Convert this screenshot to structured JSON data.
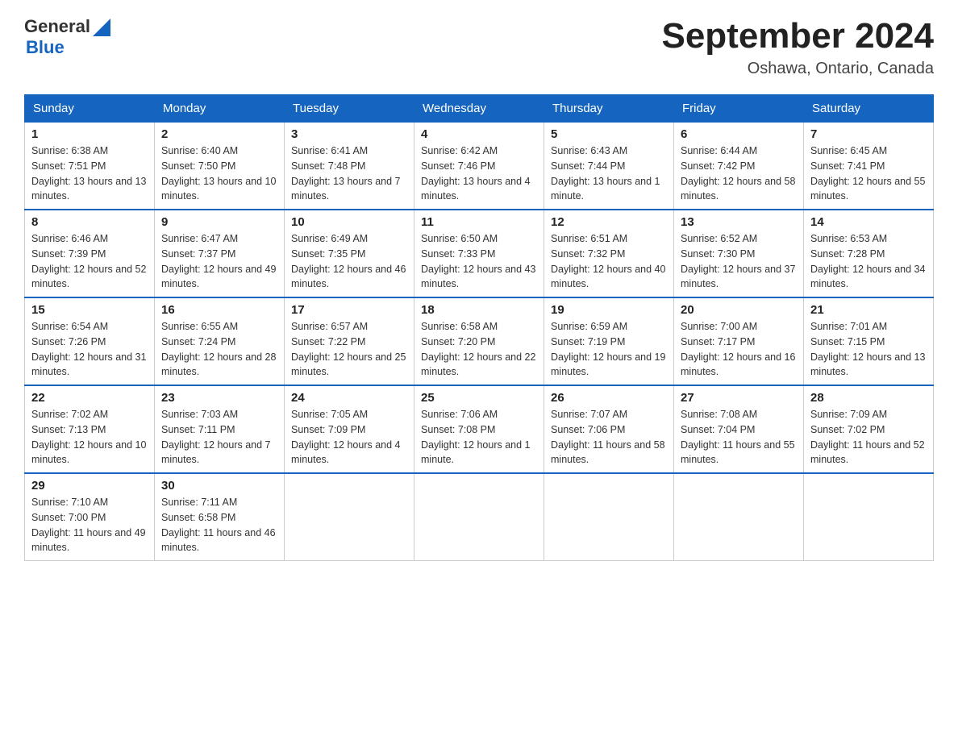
{
  "header": {
    "logo": {
      "general": "General",
      "blue": "Blue"
    },
    "title": "September 2024",
    "location": "Oshawa, Ontario, Canada"
  },
  "days_of_week": [
    "Sunday",
    "Monday",
    "Tuesday",
    "Wednesday",
    "Thursday",
    "Friday",
    "Saturday"
  ],
  "weeks": [
    [
      {
        "day": "1",
        "sunrise": "6:38 AM",
        "sunset": "7:51 PM",
        "daylight": "13 hours and 13 minutes."
      },
      {
        "day": "2",
        "sunrise": "6:40 AM",
        "sunset": "7:50 PM",
        "daylight": "13 hours and 10 minutes."
      },
      {
        "day": "3",
        "sunrise": "6:41 AM",
        "sunset": "7:48 PM",
        "daylight": "13 hours and 7 minutes."
      },
      {
        "day": "4",
        "sunrise": "6:42 AM",
        "sunset": "7:46 PM",
        "daylight": "13 hours and 4 minutes."
      },
      {
        "day": "5",
        "sunrise": "6:43 AM",
        "sunset": "7:44 PM",
        "daylight": "13 hours and 1 minute."
      },
      {
        "day": "6",
        "sunrise": "6:44 AM",
        "sunset": "7:42 PM",
        "daylight": "12 hours and 58 minutes."
      },
      {
        "day": "7",
        "sunrise": "6:45 AM",
        "sunset": "7:41 PM",
        "daylight": "12 hours and 55 minutes."
      }
    ],
    [
      {
        "day": "8",
        "sunrise": "6:46 AM",
        "sunset": "7:39 PM",
        "daylight": "12 hours and 52 minutes."
      },
      {
        "day": "9",
        "sunrise": "6:47 AM",
        "sunset": "7:37 PM",
        "daylight": "12 hours and 49 minutes."
      },
      {
        "day": "10",
        "sunrise": "6:49 AM",
        "sunset": "7:35 PM",
        "daylight": "12 hours and 46 minutes."
      },
      {
        "day": "11",
        "sunrise": "6:50 AM",
        "sunset": "7:33 PM",
        "daylight": "12 hours and 43 minutes."
      },
      {
        "day": "12",
        "sunrise": "6:51 AM",
        "sunset": "7:32 PM",
        "daylight": "12 hours and 40 minutes."
      },
      {
        "day": "13",
        "sunrise": "6:52 AM",
        "sunset": "7:30 PM",
        "daylight": "12 hours and 37 minutes."
      },
      {
        "day": "14",
        "sunrise": "6:53 AM",
        "sunset": "7:28 PM",
        "daylight": "12 hours and 34 minutes."
      }
    ],
    [
      {
        "day": "15",
        "sunrise": "6:54 AM",
        "sunset": "7:26 PM",
        "daylight": "12 hours and 31 minutes."
      },
      {
        "day": "16",
        "sunrise": "6:55 AM",
        "sunset": "7:24 PM",
        "daylight": "12 hours and 28 minutes."
      },
      {
        "day": "17",
        "sunrise": "6:57 AM",
        "sunset": "7:22 PM",
        "daylight": "12 hours and 25 minutes."
      },
      {
        "day": "18",
        "sunrise": "6:58 AM",
        "sunset": "7:20 PM",
        "daylight": "12 hours and 22 minutes."
      },
      {
        "day": "19",
        "sunrise": "6:59 AM",
        "sunset": "7:19 PM",
        "daylight": "12 hours and 19 minutes."
      },
      {
        "day": "20",
        "sunrise": "7:00 AM",
        "sunset": "7:17 PM",
        "daylight": "12 hours and 16 minutes."
      },
      {
        "day": "21",
        "sunrise": "7:01 AM",
        "sunset": "7:15 PM",
        "daylight": "12 hours and 13 minutes."
      }
    ],
    [
      {
        "day": "22",
        "sunrise": "7:02 AM",
        "sunset": "7:13 PM",
        "daylight": "12 hours and 10 minutes."
      },
      {
        "day": "23",
        "sunrise": "7:03 AM",
        "sunset": "7:11 PM",
        "daylight": "12 hours and 7 minutes."
      },
      {
        "day": "24",
        "sunrise": "7:05 AM",
        "sunset": "7:09 PM",
        "daylight": "12 hours and 4 minutes."
      },
      {
        "day": "25",
        "sunrise": "7:06 AM",
        "sunset": "7:08 PM",
        "daylight": "12 hours and 1 minute."
      },
      {
        "day": "26",
        "sunrise": "7:07 AM",
        "sunset": "7:06 PM",
        "daylight": "11 hours and 58 minutes."
      },
      {
        "day": "27",
        "sunrise": "7:08 AM",
        "sunset": "7:04 PM",
        "daylight": "11 hours and 55 minutes."
      },
      {
        "day": "28",
        "sunrise": "7:09 AM",
        "sunset": "7:02 PM",
        "daylight": "11 hours and 52 minutes."
      }
    ],
    [
      {
        "day": "29",
        "sunrise": "7:10 AM",
        "sunset": "7:00 PM",
        "daylight": "11 hours and 49 minutes."
      },
      {
        "day": "30",
        "sunrise": "7:11 AM",
        "sunset": "6:58 PM",
        "daylight": "11 hours and 46 minutes."
      },
      null,
      null,
      null,
      null,
      null
    ]
  ],
  "labels": {
    "sunrise_prefix": "Sunrise: ",
    "sunset_prefix": "Sunset: ",
    "daylight_prefix": "Daylight: "
  }
}
